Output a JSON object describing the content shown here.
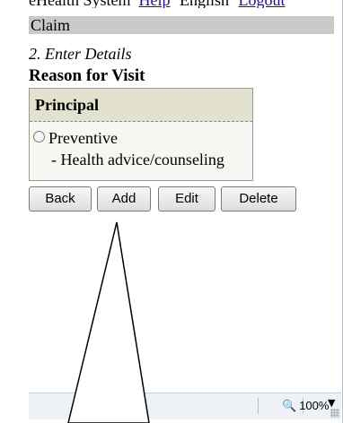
{
  "header": {
    "system_text": "eHealth System",
    "link1": "Help",
    "language": "English",
    "link2": "Logout"
  },
  "claim_bar": "Claim",
  "step_label": "2. Enter Details",
  "section_title": "Reason for Visit",
  "principal": {
    "heading": "Principal",
    "option": "Preventive",
    "suboption": "- Health advice/counseling"
  },
  "buttons": {
    "back": "Back",
    "add": "Add",
    "edit": "Edit",
    "delete": "Delete"
  },
  "status": {
    "zoom": "100%",
    "zoom_icon": "magnifier-icon",
    "dropdown_icon": "triangle-down-icon"
  },
  "annotation": {
    "type": "callout-arrow",
    "target": "add-button"
  }
}
